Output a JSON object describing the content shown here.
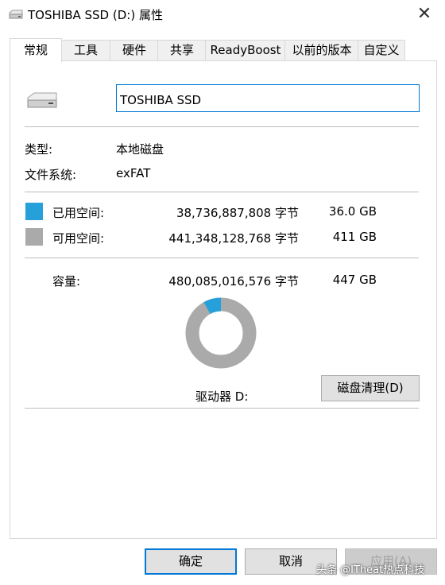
{
  "window": {
    "title": "TOSHIBA SSD (D:) 属性"
  },
  "tabs": [
    "常规",
    "工具",
    "硬件",
    "共享",
    "ReadyBoost",
    "以前的版本",
    "自定义"
  ],
  "general": {
    "drive_name": "TOSHIBA SSD",
    "type_label": "类型:",
    "type_value": "本地磁盘",
    "fs_label": "文件系统:",
    "fs_value": "exFAT",
    "used": {
      "label": "已用空间:",
      "bytes": "38,736,887,808 字节",
      "size": "36.0 GB",
      "color": "#26a0da"
    },
    "free": {
      "label": "可用空间:",
      "bytes": "441,348,128,768 字节",
      "size": "411 GB",
      "color": "#aaaaaa"
    },
    "capacity": {
      "label": "容量:",
      "bytes": "480,085,016,576 字节",
      "size": "447 GB"
    },
    "used_fraction": 0.0807,
    "drive_label": "驱动器 D:",
    "cleanup_button": "磁盘清理(D)"
  },
  "buttons": {
    "ok": "确定",
    "cancel": "取消",
    "apply": "应用(A)"
  },
  "watermark": "头条 @ITheat热点科技"
}
